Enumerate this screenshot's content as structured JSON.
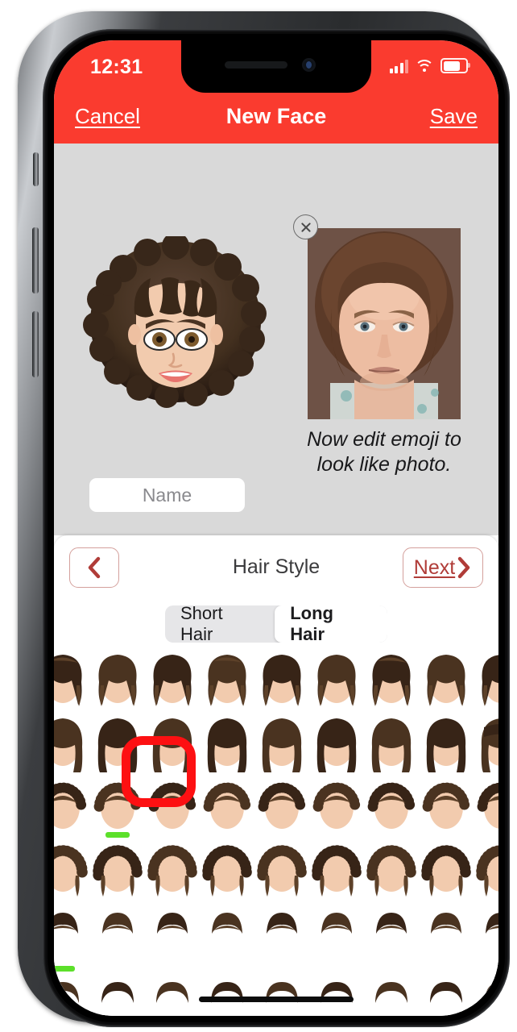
{
  "status_bar": {
    "time": "12:31",
    "cellular_icon": "signal-bars-icon",
    "wifi_icon": "wifi-icon",
    "battery_icon": "battery-icon"
  },
  "nav_bar": {
    "cancel_label": "Cancel",
    "title": "New Face",
    "save_label": "Save",
    "background_color": "#fa3b2f"
  },
  "preview": {
    "avatar_name": "emoji-avatar-preview",
    "photo_name": "reference-photo",
    "close_icon": "close-x-icon",
    "caption": "Now edit emoji to look like photo.",
    "name_placeholder": "Name",
    "name_value": ""
  },
  "editor": {
    "back_icon": "chevron-left-icon",
    "title": "Hair Style",
    "next_label": "Next",
    "next_icon": "chevron-right-icon",
    "accent_color": "#b03c38",
    "segments": [
      {
        "label": "Short Hair",
        "selected": false
      },
      {
        "label": "Long Hair",
        "selected": true
      }
    ],
    "selected_indicator_color": "#5ce02a",
    "annotation_color": "#fd1012"
  },
  "grid": {
    "rows": [
      {
        "style": "long-wavy",
        "count": 9
      },
      {
        "style": "long-straight",
        "count": 9
      },
      {
        "style": "curly-short",
        "count": 9
      },
      {
        "style": "curly-long",
        "count": 9
      },
      {
        "style": "bangs-piece",
        "count": 9
      },
      {
        "style": "hairline-piece",
        "count": 9
      }
    ],
    "selected_row": 2,
    "selected_index": 1,
    "second_selected_row": 5,
    "second_selected_index": 0
  },
  "home_indicator": "home-indicator"
}
